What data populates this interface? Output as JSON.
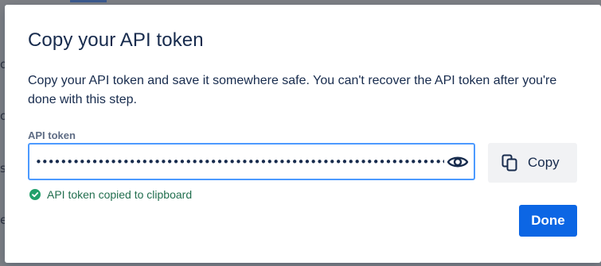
{
  "dialog": {
    "title": "Copy your API token",
    "description": "Copy your API token and save it somewhere safe. You can't recover the API token after you're done with this step.",
    "field_label": "API token",
    "token_masked": "•••••••••••••••••••••••••••••••••••••••••••••••••••••••••••••••••••••••••••••••••",
    "reveal_icon": "eye-icon",
    "copy_icon": "copy-icon",
    "copy_label": "Copy",
    "success_icon": "check-circle-icon",
    "success_message": "API token copied to clipboard",
    "done_label": "Done"
  },
  "colors": {
    "title_text": "#172b4d",
    "focus_border": "#4c9aff",
    "primary": "#0c66e4",
    "success": "#216e4e",
    "secondary_button_bg": "#f1f2f4"
  }
}
